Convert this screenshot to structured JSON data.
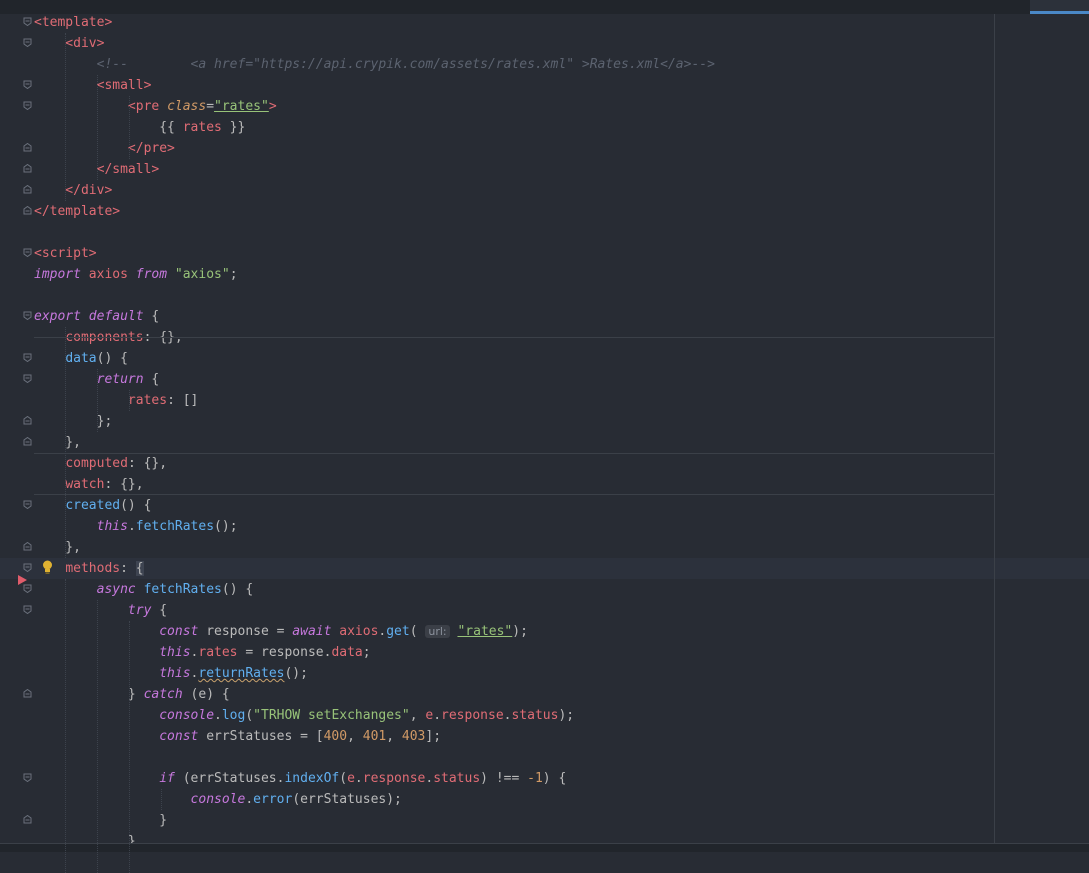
{
  "editor": {
    "lines": [
      [
        [
          "tag",
          "<template>"
        ]
      ],
      [
        [
          "tag",
          "    <div>"
        ]
      ],
      [
        [
          "cmt",
          "        <!--        <a href=\"https://api.crypik.com/assets/rates.xml\" >Rates.xml</a>-->"
        ]
      ],
      [
        [
          "tag",
          "        <small>"
        ]
      ],
      [
        [
          "tag",
          "            <pre"
        ],
        [
          "plain",
          " "
        ],
        [
          "attr",
          "class"
        ],
        [
          "plain",
          "="
        ],
        [
          "str",
          "\"rates\""
        ],
        [
          "tag",
          ">"
        ]
      ],
      [
        [
          "plain",
          "                {{ "
        ],
        [
          "prop",
          "rates"
        ],
        [
          "plain",
          " }}"
        ]
      ],
      [
        [
          "tag",
          "            </pre>"
        ]
      ],
      [
        [
          "tag",
          "        </small>"
        ]
      ],
      [
        [
          "tag",
          "    </div>"
        ]
      ],
      [
        [
          "tag",
          "</template>"
        ]
      ],
      [
        [
          "plain",
          ""
        ]
      ],
      [
        [
          "tag",
          "<script>"
        ]
      ],
      [
        [
          "kw",
          "import"
        ],
        [
          "plain",
          " "
        ],
        [
          "prop",
          "axios"
        ],
        [
          "plain",
          " "
        ],
        [
          "kw",
          "from"
        ],
        [
          "plain",
          " "
        ],
        [
          "str",
          "\"axios\""
        ],
        [
          "plain",
          ";"
        ]
      ],
      [
        [
          "plain",
          ""
        ]
      ],
      [
        [
          "kw",
          "export"
        ],
        [
          "plain",
          " "
        ],
        [
          "kw",
          "default"
        ],
        [
          "plain",
          " {"
        ]
      ],
      [
        [
          "plain",
          "    "
        ],
        [
          "prop",
          "components"
        ],
        [
          "plain",
          ": {},"
        ]
      ],
      [
        [
          "plain",
          "    "
        ],
        [
          "fn",
          "data"
        ],
        [
          "plain",
          "() {"
        ]
      ],
      [
        [
          "plain",
          "        "
        ],
        [
          "kw",
          "return"
        ],
        [
          "plain",
          " {"
        ]
      ],
      [
        [
          "plain",
          "            "
        ],
        [
          "prop",
          "rates"
        ],
        [
          "plain",
          ": []"
        ]
      ],
      [
        [
          "plain",
          "        };"
        ]
      ],
      [
        [
          "plain",
          "    },"
        ]
      ],
      [
        [
          "plain",
          "    "
        ],
        [
          "prop",
          "computed"
        ],
        [
          "plain",
          ": {},"
        ]
      ],
      [
        [
          "plain",
          "    "
        ],
        [
          "prop",
          "watch"
        ],
        [
          "plain",
          ": {},"
        ]
      ],
      [
        [
          "plain",
          "    "
        ],
        [
          "fn",
          "created"
        ],
        [
          "plain",
          "() {"
        ]
      ],
      [
        [
          "plain",
          "        "
        ],
        [
          "kw",
          "this"
        ],
        [
          "plain",
          "."
        ],
        [
          "fn",
          "fetchRates"
        ],
        [
          "plain",
          "();"
        ]
      ],
      [
        [
          "plain",
          "    },"
        ]
      ],
      [
        [
          "plain",
          "    "
        ],
        [
          "prop",
          "methods"
        ],
        [
          "plain",
          ": "
        ],
        [
          "caret",
          "{"
        ]
      ],
      [
        [
          "plain",
          "        "
        ],
        [
          "kw",
          "async"
        ],
        [
          "plain",
          " "
        ],
        [
          "fn",
          "fetchRates"
        ],
        [
          "plain",
          "() {"
        ]
      ],
      [
        [
          "plain",
          "            "
        ],
        [
          "kw",
          "try"
        ],
        [
          "plain",
          " {"
        ]
      ],
      [
        [
          "plain",
          "                "
        ],
        [
          "kw",
          "const"
        ],
        [
          "plain",
          " response = "
        ],
        [
          "kw",
          "await"
        ],
        [
          "plain",
          " "
        ],
        [
          "prop",
          "axios"
        ],
        [
          "plain",
          "."
        ],
        [
          "fn",
          "get"
        ],
        [
          "plain",
          "( "
        ],
        [
          "hint",
          "url:"
        ],
        [
          "plain",
          " "
        ],
        [
          "str",
          "\"rates\""
        ],
        [
          "plain",
          ");"
        ]
      ],
      [
        [
          "plain",
          "                "
        ],
        [
          "kw",
          "this"
        ],
        [
          "plain",
          "."
        ],
        [
          "prop",
          "rates"
        ],
        [
          "plain",
          " = response."
        ],
        [
          "prop",
          "data"
        ],
        [
          "plain",
          ";"
        ]
      ],
      [
        [
          "plain",
          "                "
        ],
        [
          "kw",
          "this"
        ],
        [
          "plain",
          "."
        ],
        [
          "fn",
          "returnRates"
        ],
        [
          "plain",
          "();"
        ]
      ],
      [
        [
          "plain",
          "            } "
        ],
        [
          "kw",
          "catch"
        ],
        [
          "plain",
          " (e) {"
        ]
      ],
      [
        [
          "plain",
          "                "
        ],
        [
          "kw",
          "console"
        ],
        [
          "plain",
          "."
        ],
        [
          "fn",
          "log"
        ],
        [
          "plain",
          "("
        ],
        [
          "str",
          "\"TRHOW setExchanges\""
        ],
        [
          "plain",
          ", "
        ],
        [
          "prop",
          "e"
        ],
        [
          "plain",
          "."
        ],
        [
          "prop",
          "response"
        ],
        [
          "plain",
          "."
        ],
        [
          "prop",
          "status"
        ],
        [
          "plain",
          ");"
        ]
      ],
      [
        [
          "plain",
          "                "
        ],
        [
          "kw",
          "const"
        ],
        [
          "plain",
          " errStatuses = ["
        ],
        [
          "num",
          "400"
        ],
        [
          "plain",
          ", "
        ],
        [
          "num",
          "401"
        ],
        [
          "plain",
          ", "
        ],
        [
          "num",
          "403"
        ],
        [
          "plain",
          "];"
        ]
      ],
      [
        [
          "plain",
          ""
        ]
      ],
      [
        [
          "plain",
          "                "
        ],
        [
          "kw",
          "if"
        ],
        [
          "plain",
          " (errStatuses."
        ],
        [
          "fn",
          "indexOf"
        ],
        [
          "plain",
          "("
        ],
        [
          "prop",
          "e"
        ],
        [
          "plain",
          "."
        ],
        [
          "prop",
          "response"
        ],
        [
          "plain",
          "."
        ],
        [
          "prop",
          "status"
        ],
        [
          "plain",
          ") !== "
        ],
        [
          "num",
          "-1"
        ],
        [
          "plain",
          ") {"
        ]
      ],
      [
        [
          "plain",
          "                    "
        ],
        [
          "kw",
          "console"
        ],
        [
          "plain",
          "."
        ],
        [
          "fn",
          "error"
        ],
        [
          "plain",
          "(errStatuses);"
        ]
      ],
      [
        [
          "plain",
          "                }"
        ]
      ],
      [
        [
          "plain",
          "            }"
        ]
      ]
    ]
  },
  "colors": {
    "background": "#282c34",
    "tag": "#e06c75",
    "keyword": "#c678dd",
    "function": "#61afef",
    "string": "#98c379",
    "number": "#d19a66",
    "comment": "#5c6370",
    "accent": "#4a88c7"
  },
  "icons": {
    "lightbulb": "lightbulb-icon",
    "breakpoint": "breakpoint-arrow-icon",
    "fold": "fold-toggle-icon"
  }
}
